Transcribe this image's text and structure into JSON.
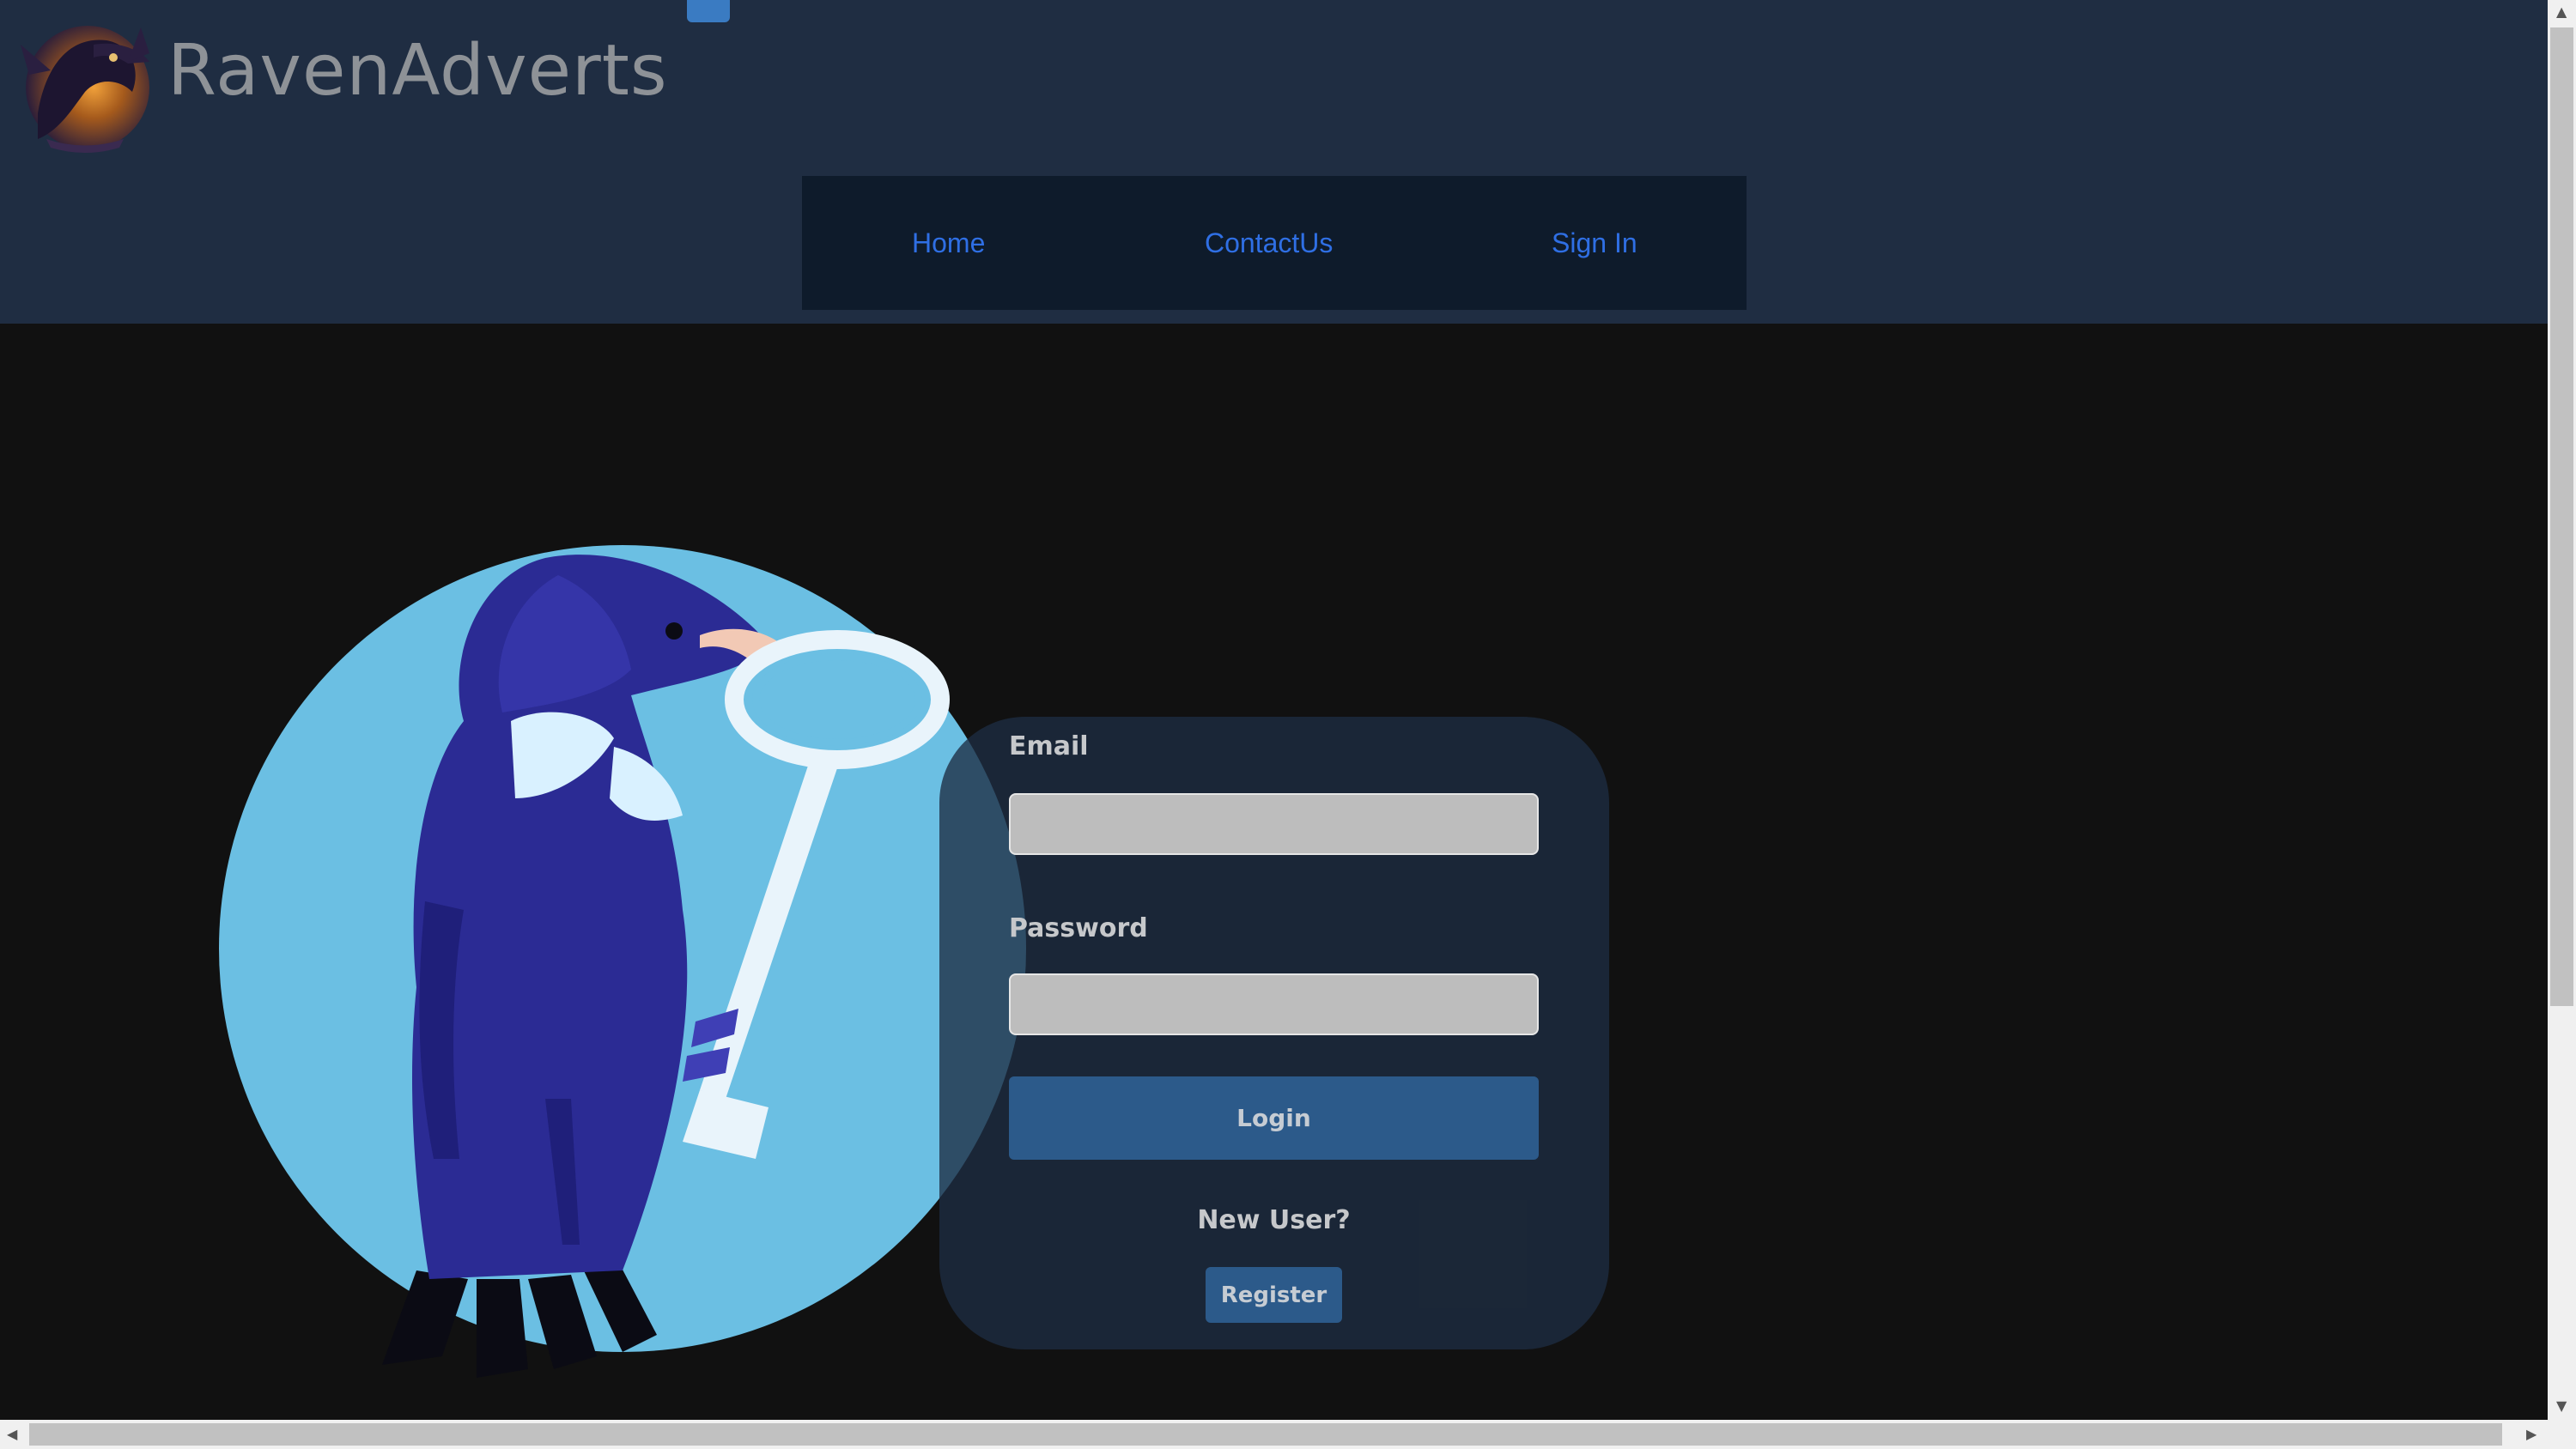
{
  "brand": {
    "name": "RavenAdverts",
    "logo_icon": "raven-emblem-icon"
  },
  "nav": {
    "items": [
      {
        "label": "Home"
      },
      {
        "label": "ContactUs"
      },
      {
        "label": "Sign In"
      }
    ],
    "link_color": "#2f6fe4"
  },
  "login": {
    "email_label": "Email",
    "email_value": "",
    "password_label": "Password",
    "password_value": "",
    "login_button": "Login",
    "new_user_text": "New User?",
    "register_button": "Register"
  },
  "illustration": {
    "icon": "raven-holding-key-illustration"
  },
  "colors": {
    "header_bg": "#1f2d42",
    "page_bg": "#111111",
    "button_bg": "#2c5a8a",
    "circle_bg": "#6bbfe3"
  }
}
